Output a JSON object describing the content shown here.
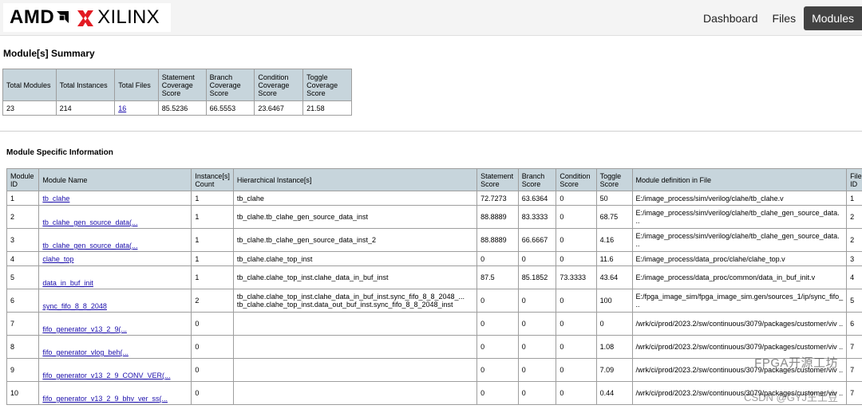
{
  "header": {
    "logo_text_amd": "AMD",
    "logo_text_xilinx": "XILINX",
    "nav": [
      {
        "label": "Dashboard"
      },
      {
        "label": "Files"
      },
      {
        "label": "Modules"
      }
    ]
  },
  "summary": {
    "title": "Module[s] Summary",
    "headers": [
      "Total Modules",
      "Total Instances",
      "Total Files",
      "Statement Coverage Score",
      "Branch Coverage Score",
      "Condition Coverage Score",
      "Toggle Coverage Score"
    ],
    "values": [
      "23",
      "214",
      "16",
      "85.5236",
      "66.5553",
      "23.6467",
      "21.58"
    ]
  },
  "details": {
    "title": "Module Specific Information",
    "headers": [
      "Module ID",
      "Module Name",
      "Instance[s] Count",
      "Hierarchical Instance[s]",
      "Statement Score",
      "Branch Score",
      "Condition Score",
      "Toggle Score",
      "Module definition in File",
      "File ID"
    ],
    "rows": [
      {
        "id": "1",
        "name": "tb_clahe",
        "count": "1",
        "hier": "tb_clahe",
        "stmt": "72.7273",
        "branch": "63.6364",
        "cond": "0",
        "toggle": "50",
        "file": "E:/image_process/sim/verilog/clahe/tb_clahe.v",
        "fid": "1"
      },
      {
        "id": "2",
        "name": "tb_clahe_gen_source_data(...",
        "count": "1",
        "hier": "tb_clahe.tb_clahe_gen_source_data_inst",
        "stmt": "88.8889",
        "branch": "83.3333",
        "cond": "0",
        "toggle": "68.75",
        "file": "E:/image_process/sim/verilog/clahe/tb_clahe_gen_source_data. ..",
        "fid": "2"
      },
      {
        "id": "3",
        "name": "tb_clahe_gen_source_data(...",
        "count": "1",
        "hier": "tb_clahe.tb_clahe_gen_source_data_inst_2",
        "stmt": "88.8889",
        "branch": "66.6667",
        "cond": "0",
        "toggle": "4.16",
        "file": "E:/image_process/sim/verilog/clahe/tb_clahe_gen_source_data. ..",
        "fid": "2"
      },
      {
        "id": "4",
        "name": "clahe_top",
        "count": "1",
        "hier": "tb_clahe.clahe_top_inst",
        "stmt": "0",
        "branch": "0",
        "cond": "0",
        "toggle": "11.6",
        "file": "E:/image_process/data_proc/clahe/clahe_top.v",
        "fid": "3"
      },
      {
        "id": "5",
        "name": "data_in_buf_init",
        "count": "1",
        "hier": "tb_clahe.clahe_top_inst.clahe_data_in_buf_inst",
        "stmt": "87.5",
        "branch": "85.1852",
        "cond": "73.3333",
        "toggle": "43.64",
        "file": "E:/image_process/data_proc/common/data_in_buf_init.v",
        "fid": "4"
      },
      {
        "id": "6",
        "name": "sync_fifo_8_8_2048",
        "count": "2",
        "hier": "tb_clahe.clahe_top_inst.clahe_data_in_buf_inst.sync_fifo_8_8_2048_...\ntb_clahe.clahe_top_inst.data_out_buf_inst.sync_fifo_8_8_2048_inst",
        "stmt": "0",
        "branch": "0",
        "cond": "0",
        "toggle": "100",
        "file": "E:/fpga_image_sim/fpga_image_sim.gen/sources_1/ip/sync_fifo_ ..",
        "fid": "5"
      },
      {
        "id": "7",
        "name": "fifo_generator_v13_2_9(...",
        "count": "0",
        "hier": "",
        "stmt": "0",
        "branch": "0",
        "cond": "0",
        "toggle": "0",
        "file": "/wrk/ci/prod/2023.2/sw/continuous/3079/packages/customer/viv ..",
        "fid": "6"
      },
      {
        "id": "8",
        "name": "fifo_generator_vlog_beh(...",
        "count": "0",
        "hier": "",
        "stmt": "0",
        "branch": "0",
        "cond": "0",
        "toggle": "1.08",
        "file": "/wrk/ci/prod/2023.2/sw/continuous/3079/packages/customer/viv ..",
        "fid": "7"
      },
      {
        "id": "9",
        "name": "fifo_generator_v13_2_9_CONV_VER(...",
        "count": "0",
        "hier": "",
        "stmt": "0",
        "branch": "0",
        "cond": "0",
        "toggle": "7.09",
        "file": "/wrk/ci/prod/2023.2/sw/continuous/3079/packages/customer/viv ..",
        "fid": "7"
      },
      {
        "id": "10",
        "name": "fifo_generator_v13_2_9_bhv_ver_ss(...",
        "count": "0",
        "hier": "",
        "stmt": "0",
        "branch": "0",
        "cond": "0",
        "toggle": "0.44",
        "file": "/wrk/ci/prod/2023.2/sw/continuous/3079/packages/customer/viv ..",
        "fid": "7"
      }
    ]
  },
  "watermark": {
    "line1": "FPGA开源工坊",
    "line2": "CSDN @GYJ王土豆"
  }
}
